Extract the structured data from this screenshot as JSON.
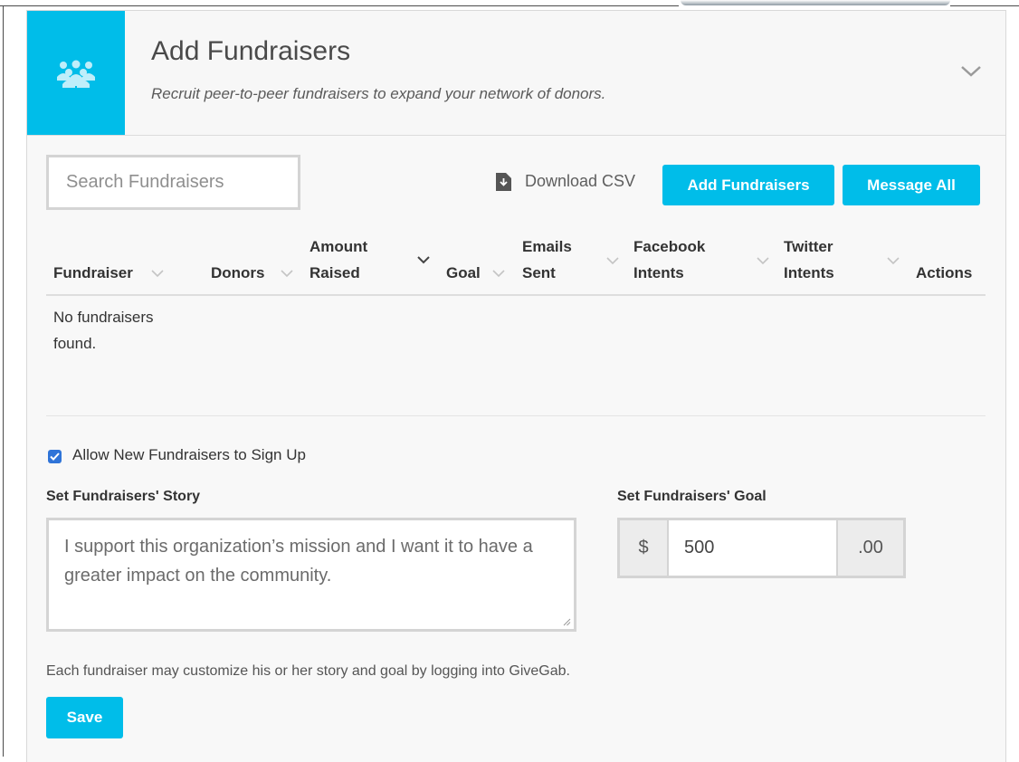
{
  "header": {
    "title": "Add Fundraisers",
    "subtitle": "Recruit peer-to-peer fundraisers to expand your network of donors.",
    "icon": "group-icon",
    "collapse_icon": "chevron-down-icon"
  },
  "toolbar": {
    "search_placeholder": "Search Fundraisers",
    "download_label": "Download CSV",
    "add_label": "Add Fundraisers",
    "message_label": "Message All"
  },
  "table": {
    "columns": [
      {
        "line1": "Fundraiser",
        "line2": ""
      },
      {
        "line1": "Donors",
        "line2": ""
      },
      {
        "line1": "Amount",
        "line2": "Raised"
      },
      {
        "line1": "Goal",
        "line2": ""
      },
      {
        "line1": "Emails",
        "line2": "Sent"
      },
      {
        "line1": "Facebook",
        "line2": "Intents"
      },
      {
        "line1": "Twitter",
        "line2": "Intents"
      },
      {
        "line1": "Actions",
        "line2": ""
      }
    ],
    "empty_message": "No fundraisers found."
  },
  "settings": {
    "allow_signup_label": "Allow New Fundraisers to Sign Up",
    "allow_signup_checked": true,
    "story_label": "Set Fundraisers' Story",
    "story_placeholder": "I support this organization’s mission and I want it to have a greater impact on the community.",
    "goal_label": "Set Fundraisers' Goal",
    "goal_prefix": "$",
    "goal_value": "500",
    "goal_suffix": ".00",
    "note": "Each fundraiser may customize his or her story and goal by logging into GiveGab.",
    "save_label": "Save"
  },
  "colors": {
    "accent": "#00bde9",
    "checkbox": "#2f74d8"
  }
}
